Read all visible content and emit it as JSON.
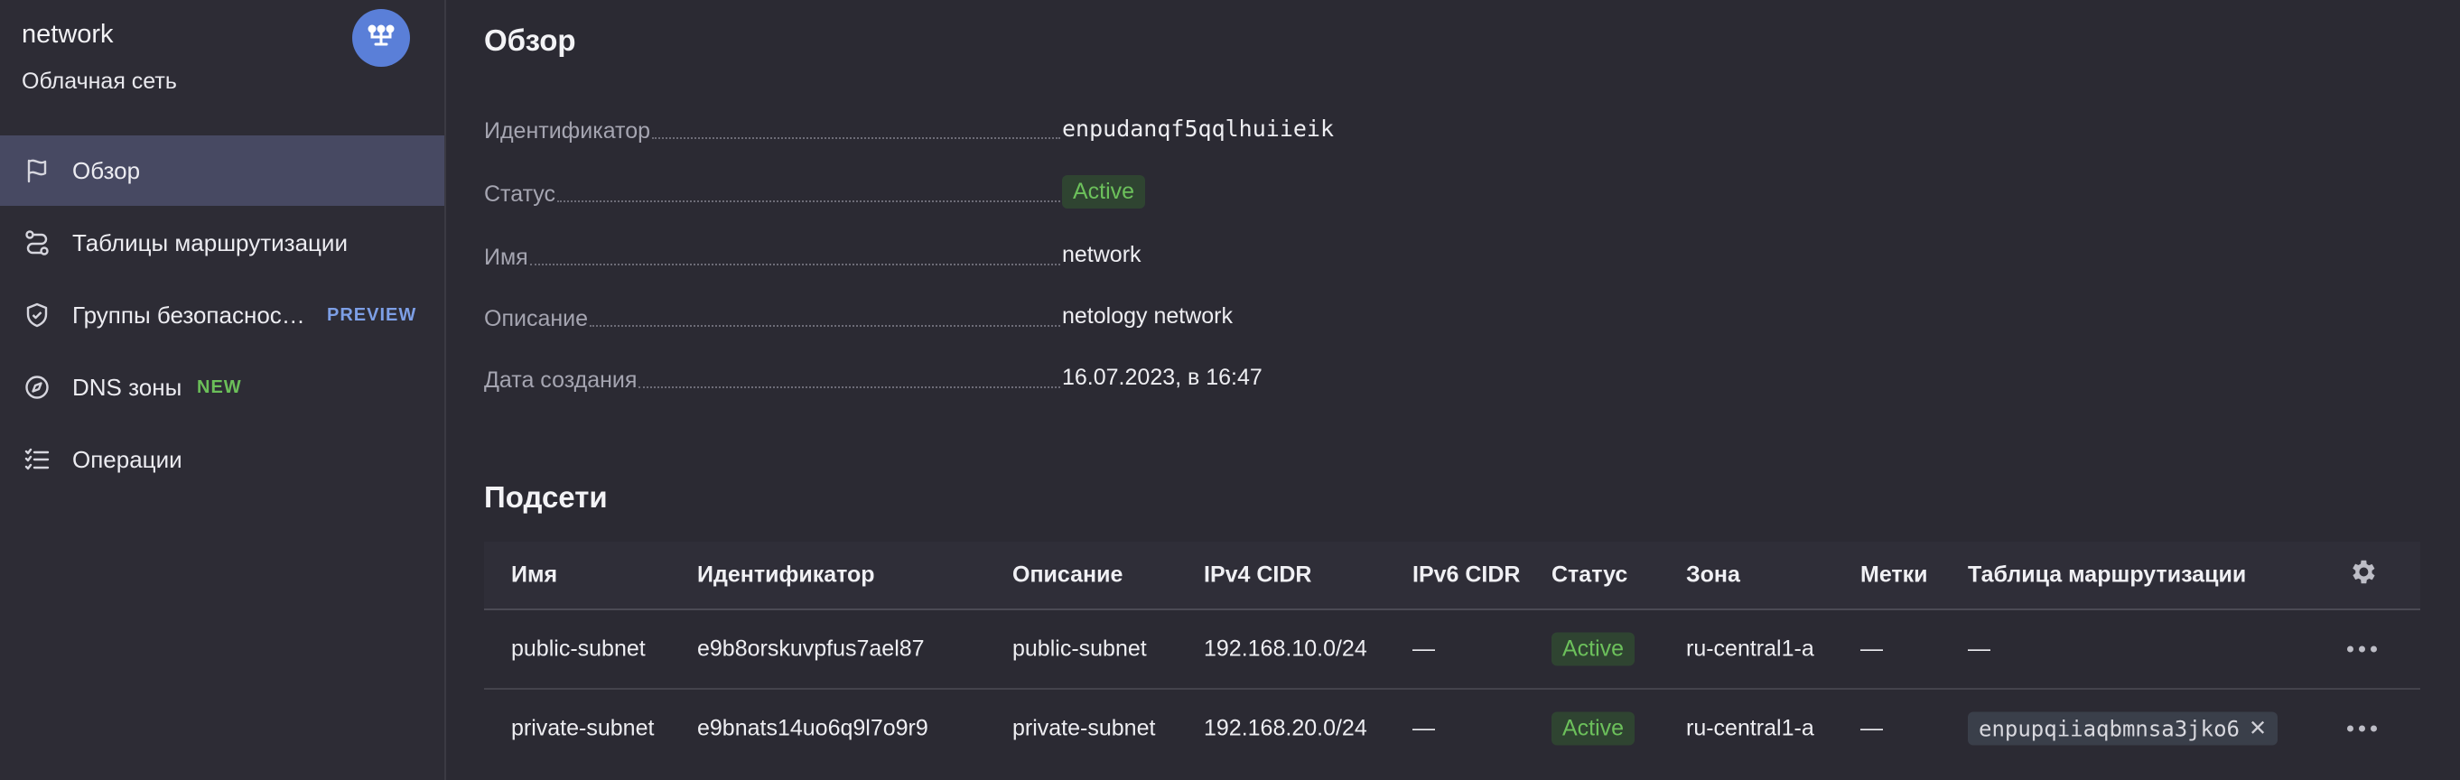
{
  "sidebar": {
    "title": "network",
    "subtitle": "Облачная сеть",
    "items": [
      {
        "label": "Обзор",
        "icon": "flag-icon",
        "active": true
      },
      {
        "label": "Таблицы маршрутизации",
        "icon": "route-icon"
      },
      {
        "label": "Группы безопаснос…",
        "icon": "shield-icon",
        "badge": "PREVIEW"
      },
      {
        "label": "DNS зоны",
        "icon": "compass-icon",
        "badge": "NEW"
      },
      {
        "label": "Операции",
        "icon": "checklist-icon"
      }
    ]
  },
  "overview": {
    "title": "Обзор",
    "props": [
      {
        "key": "Идентификатор",
        "value": "enpudanqf5qqlhuiieik"
      },
      {
        "key": "Статус",
        "value": "Active"
      },
      {
        "key": "Имя",
        "value": "network"
      },
      {
        "key": "Описание",
        "value": "netology network"
      },
      {
        "key": "Дата создания",
        "value": "16.07.2023, в 16:47"
      }
    ]
  },
  "subnets": {
    "title": "Подсети",
    "columns": [
      "Имя",
      "Идентификатор",
      "Описание",
      "IPv4 CIDR",
      "IPv6 CIDR",
      "Статус",
      "Зона",
      "Метки",
      "Таблица маршрутизации"
    ],
    "rows": [
      {
        "name": "public-subnet",
        "id": "e9b8orskuvpfus7ael87",
        "description": "public-subnet",
        "ipv4": "192.168.10.0/24",
        "ipv6": "—",
        "status": "Active",
        "zone": "ru-central1-a",
        "labels": "—",
        "route_table": "—"
      },
      {
        "name": "private-subnet",
        "id": "e9bnats14uo6q9l7o9r9",
        "description": "private-subnet",
        "ipv4": "192.168.20.0/24",
        "ipv6": "—",
        "status": "Active",
        "zone": "ru-central1-a",
        "labels": "—",
        "route_table": "enpupqiiaqbmnsa3jko6"
      }
    ]
  },
  "colors": {
    "accent": "#5a7fd8",
    "active": "#6cc05b",
    "preview": "#7d9fe6",
    "new": "#6bbf59"
  }
}
